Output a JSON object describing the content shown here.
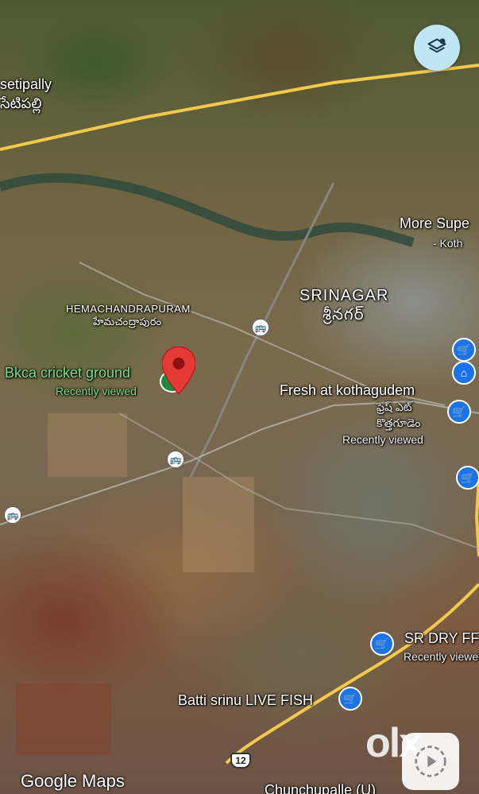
{
  "map": {
    "places": {
      "setipally": "setipally",
      "setipally_te": "సేటిపల్లి",
      "more_super": "More Supe",
      "more_super_sub": "- Koth",
      "srinagar": "SRINAGAR",
      "srinagar_te": "శ్రీనగర్",
      "hemachandrapuram": "HEMACHANDRAPURAM",
      "hemachandrapuram_te": "హేమచంద్రాపురం",
      "bkca": "Bkca cricket ground",
      "bkca_sub": "Recently viewed",
      "fresh": "Fresh at kothagudem",
      "fresh_te1": "ఫ్రెష్ ఎట్",
      "fresh_te2": "కొత్తగూడెం",
      "fresh_sub": "Recently viewed",
      "srdry": "SR DRY FF",
      "srdry_sub": "Recently viewed",
      "batti": "Batti srinu LIVE FISH",
      "chunchupalle": "Chunchupalle (U)"
    },
    "highway_shield": "12",
    "attribution": "Google Maps",
    "watermark": "olx"
  },
  "icons": {
    "layers": "layers-icon",
    "selected_pin": "red-location-pin-icon",
    "shopping_bag": "shopping-bag-icon",
    "home": "home-icon",
    "cart": "shopping-cart-icon",
    "transit": "bus-stop-icon",
    "play": "play-icon"
  },
  "colors": {
    "selected_pin": "#e53935",
    "place_pin": "#1a73e8",
    "recent_label": "#7ddf86",
    "road": "#f2c94c"
  }
}
